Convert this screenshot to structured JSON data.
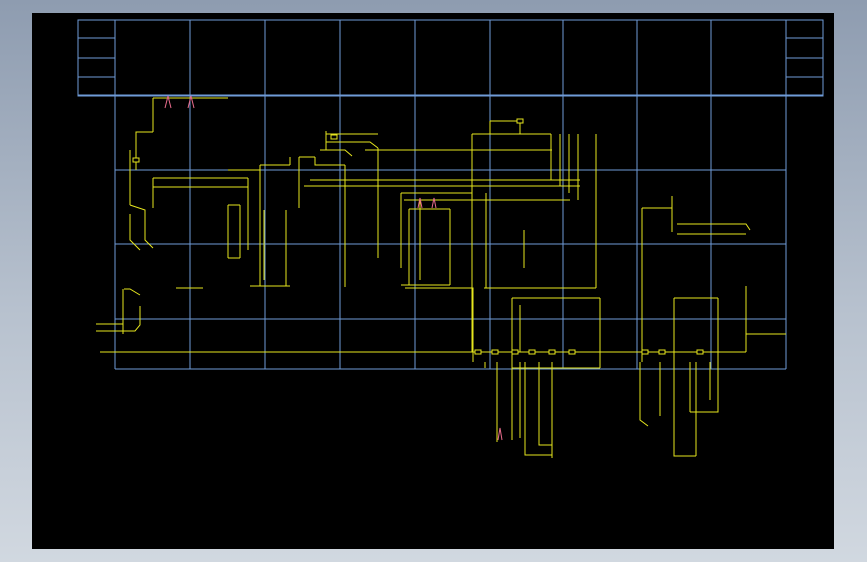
{
  "viewer": {
    "background": "#000000",
    "frame_color": "#9aa6b8"
  },
  "drawing": {
    "grid_color": "#6f9bd8",
    "pipe_color": "#e6e61e",
    "marker_color": "#e86c8c",
    "grid_columns": 9,
    "grid_rows": 4,
    "valve_count": 12
  }
}
